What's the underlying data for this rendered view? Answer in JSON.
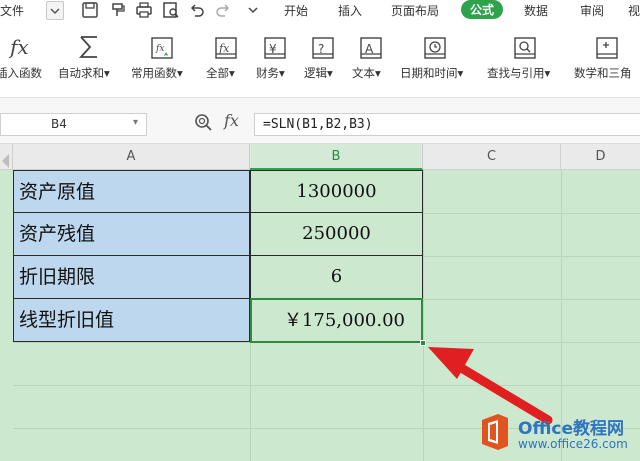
{
  "menubar": {
    "file_label": "文件",
    "tabs": [
      {
        "label": "开始",
        "active": false
      },
      {
        "label": "插入",
        "active": false
      },
      {
        "label": "页面布局",
        "active": false
      },
      {
        "label": "公式",
        "active": true
      },
      {
        "label": "数据",
        "active": false
      },
      {
        "label": "审阅",
        "active": false
      },
      {
        "label": "视",
        "active": false
      }
    ],
    "quick_icons": [
      "save-icon",
      "format-painter-icon",
      "print-icon",
      "print-preview-icon",
      "undo-icon",
      "redo-icon",
      "more-icon"
    ]
  },
  "ribbon": {
    "items": [
      {
        "label": "插入函数",
        "icon": "fx-icon"
      },
      {
        "label": "自动求和▾",
        "icon": "sigma-icon"
      },
      {
        "label": "常用函数▾",
        "icon": "star-function-icon"
      },
      {
        "label": "全部▾",
        "icon": "all-functions-icon"
      },
      {
        "label": "财务▾",
        "icon": "finance-icon"
      },
      {
        "label": "逻辑▾",
        "icon": "logic-icon"
      },
      {
        "label": "文本▾",
        "icon": "text-icon"
      },
      {
        "label": "日期和时间▾",
        "icon": "clock-icon"
      },
      {
        "label": "查找与引用▾",
        "icon": "lookup-icon"
      },
      {
        "label": "数学和三角",
        "icon": "math-icon"
      }
    ]
  },
  "formula_bar": {
    "name_box": "B4",
    "fx_label": "fx",
    "formula": "=SLN(B1,B2,B3)"
  },
  "sheet": {
    "columns": [
      "A",
      "B",
      "C",
      "D"
    ],
    "selected_column": "B",
    "rows": [
      {
        "label": "资产原值",
        "value": "1300000"
      },
      {
        "label": "资产残值",
        "value": "250000"
      },
      {
        "label": "折旧期限",
        "value": "6"
      },
      {
        "label": "线型折旧值",
        "value": "￥175,000.00"
      }
    ],
    "selected_cell": "B4"
  },
  "colors": {
    "accent": "#2ea24c",
    "label_fill": "#bdd7ee",
    "sheet_fill": "#cce8cf",
    "arrow": "#e02020"
  },
  "watermark": {
    "title": "Office教程网",
    "url": "www.office26.com"
  }
}
